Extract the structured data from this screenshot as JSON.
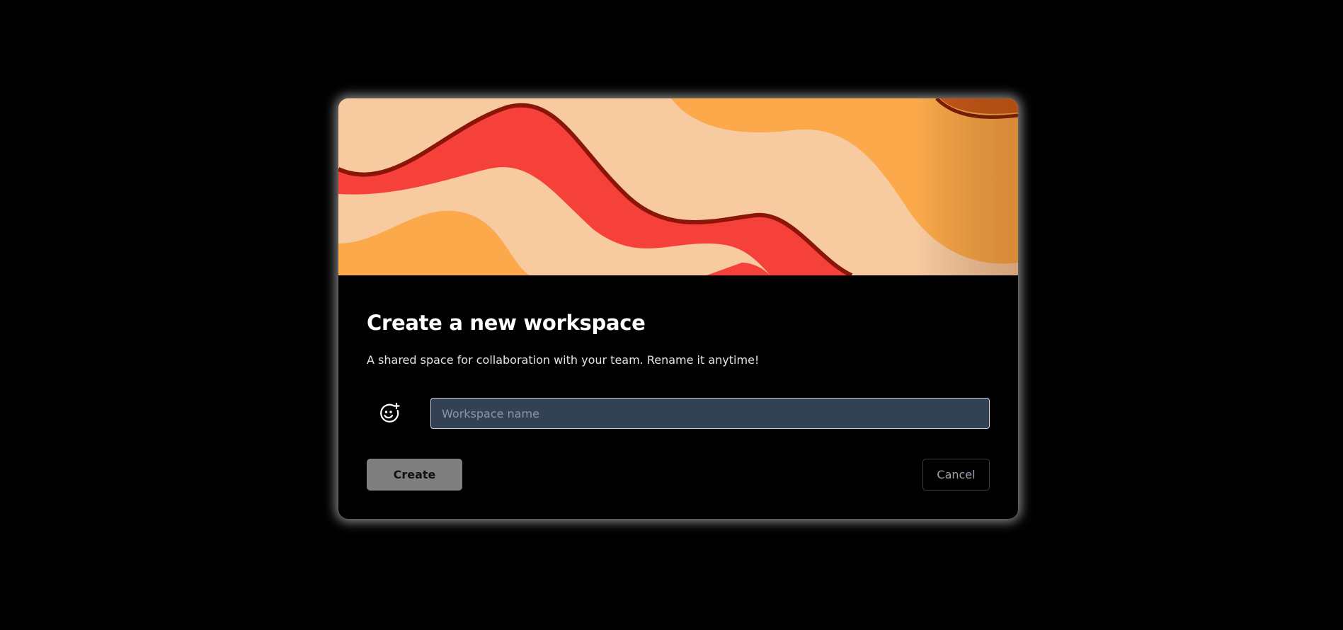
{
  "modal": {
    "title": "Create a new workspace",
    "subtitle": "A shared space for collaboration with your team. Rename it anytime!",
    "banner": {
      "description_icon": "wavy-abstract-banner",
      "colors": [
        "#f8caa0",
        "#f5413a",
        "#fba94a",
        "#8a1508"
      ]
    },
    "emoji_picker": {
      "icon": "smiley-plus-icon"
    },
    "workspace_name": {
      "value": "",
      "placeholder": "Workspace name"
    },
    "create_label": "Create",
    "cancel_label": "Cancel"
  },
  "colors": {
    "background": "#000000",
    "input_bg": "#334155",
    "create_bg": "#7f7f7f",
    "cancel_text": "#9ca3af"
  }
}
